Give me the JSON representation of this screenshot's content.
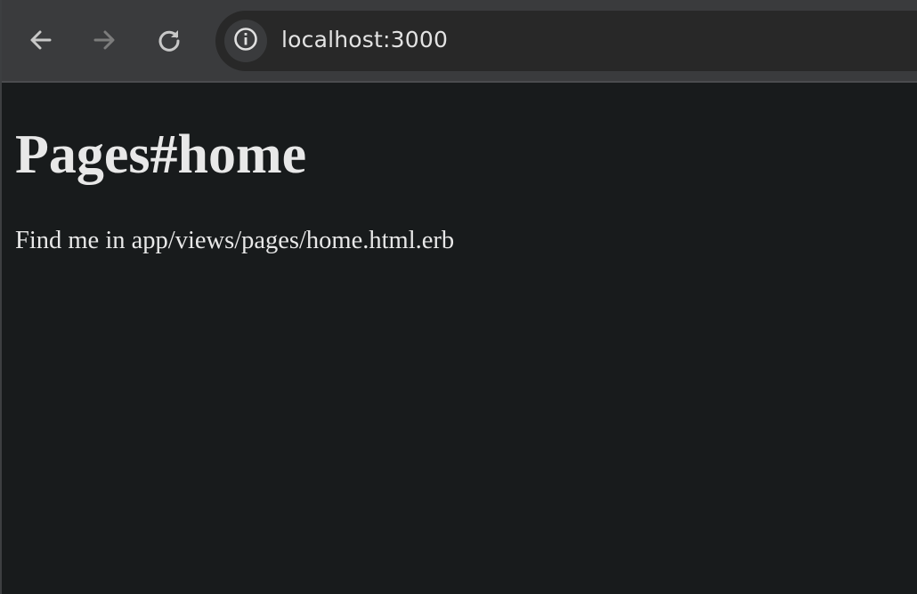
{
  "browser": {
    "icons": {
      "back": "arrow-left-icon",
      "forward": "arrow-right-icon",
      "reload": "reload-icon",
      "site_info": "info-circle-icon"
    },
    "address_bar": {
      "url": "localhost:3000"
    },
    "colors": {
      "toolbar": "#3a3b3d",
      "omnibox": "#282828",
      "page_background": "#181b1c",
      "text": "#e8e8e8"
    }
  },
  "page": {
    "heading": "Pages#home",
    "body_text": "Find me in app/views/pages/home.html.erb"
  }
}
